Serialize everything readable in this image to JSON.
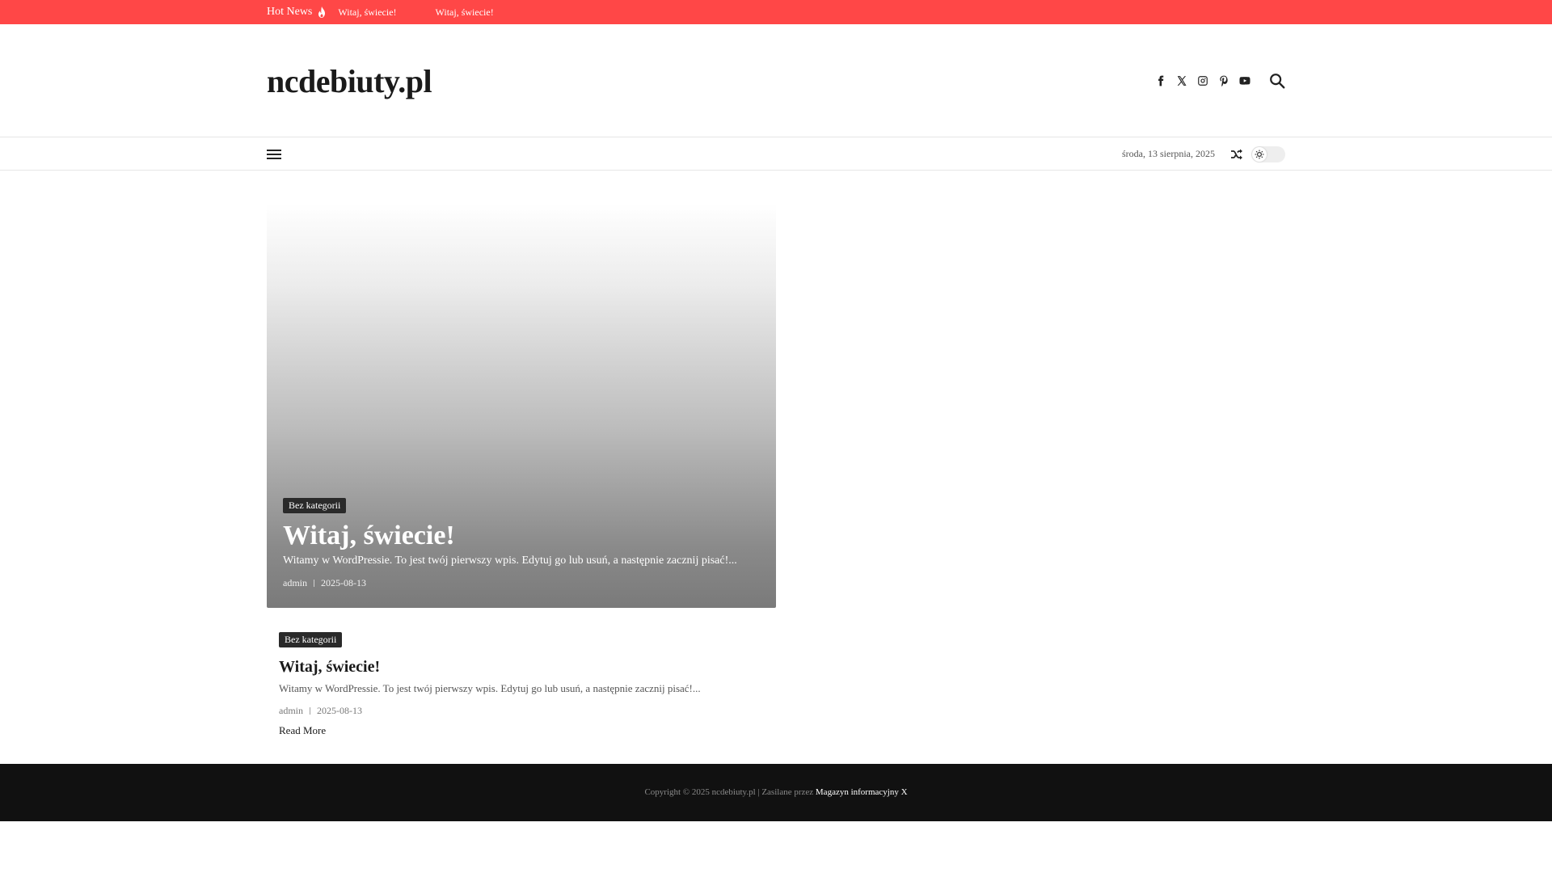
{
  "topbar": {
    "hot_label": "Hot News",
    "ticker": [
      "Witaj, świecie!",
      "Witaj, świecie!"
    ],
    "background": "#ff4747"
  },
  "header": {
    "site_title": "ncdebiuty.pl",
    "social_icons": [
      "facebook-icon",
      "x-icon",
      "instagram-icon",
      "pinterest-icon",
      "youtube-icon"
    ],
    "search_icon": "search-icon"
  },
  "nav": {
    "menu_icon": "hamburger-menu-icon",
    "date": "środa, 13 sierpnia, 2025",
    "shuffle_icon": "shuffle-icon",
    "theme_toggle_icon": "sun-icon"
  },
  "featured": {
    "category": "Bez kategorii",
    "title": "Witaj, świecie!",
    "excerpt": "Witamy w WordPressie. To jest twój pierwszy wpis. Edytuj go lub usuń, a następnie zacznij pisać!...",
    "author": "admin",
    "date": "2025-08-13"
  },
  "post": {
    "category": "Bez kategorii",
    "title": "Witaj, świecie!",
    "excerpt": "Witamy w WordPressie. To jest twój pierwszy wpis. Edytuj go lub usuń, a następnie zacznij pisać!...",
    "author": "admin",
    "date": "2025-08-13",
    "read_more": "Read More"
  },
  "footer": {
    "copyright": "Copyright © 2025 ncdebiuty.pl | Zasilane przez",
    "theme_link": "Magazyn informacyjny X",
    "background": "#111111"
  }
}
